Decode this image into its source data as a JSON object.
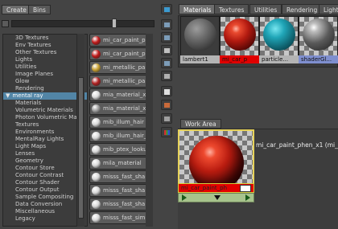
{
  "left_tabs": [
    "Create",
    "Bins"
  ],
  "tree": {
    "items": [
      {
        "label": "3D Textures",
        "kind": "top"
      },
      {
        "label": "Env Textures",
        "kind": "top"
      },
      {
        "label": "Other Textures",
        "kind": "top"
      },
      {
        "label": "Lights",
        "kind": "top"
      },
      {
        "label": "Utilities",
        "kind": "top"
      },
      {
        "label": "Image Planes",
        "kind": "top"
      },
      {
        "label": "Glow",
        "kind": "top"
      },
      {
        "label": "Rendering",
        "kind": "top"
      },
      {
        "label": "mental ray",
        "kind": "selected"
      },
      {
        "label": "Materials",
        "kind": "child"
      },
      {
        "label": "Volumetric Materials",
        "kind": "child"
      },
      {
        "label": "Photon Volumetric Ma...",
        "kind": "child"
      },
      {
        "label": "Textures",
        "kind": "child"
      },
      {
        "label": "Environments",
        "kind": "child"
      },
      {
        "label": "MentalRay Lights",
        "kind": "child"
      },
      {
        "label": "Light Maps",
        "kind": "child"
      },
      {
        "label": "Lenses",
        "kind": "child"
      },
      {
        "label": "Geometry",
        "kind": "child"
      },
      {
        "label": "Contour Store",
        "kind": "child"
      },
      {
        "label": "Contour Contrast",
        "kind": "child"
      },
      {
        "label": "Contour Shader",
        "kind": "child"
      },
      {
        "label": "Contour Output",
        "kind": "child"
      },
      {
        "label": "Sample Compositing",
        "kind": "child"
      },
      {
        "label": "Data Conversion",
        "kind": "child"
      },
      {
        "label": "Miscellaneous",
        "kind": "child"
      },
      {
        "label": "Legacy",
        "kind": "child"
      }
    ]
  },
  "nodes": [
    {
      "label": "mi_car_paint_p",
      "color": "#c01818"
    },
    {
      "label": "mi_car_paint_p",
      "color": "#c01818"
    },
    {
      "label": "mi_metallic_pai",
      "color": "#c8a030"
    },
    {
      "label": "mi_metallic_pai",
      "color": "#b02020"
    },
    {
      "label": "mia_material_x",
      "color": "#dcdcdc"
    },
    {
      "label": "mia_material_x",
      "color": "#9a9a9a"
    },
    {
      "label": "mib_illum_hair",
      "color": "#d8d8d8"
    },
    {
      "label": "mib_illum_hair_",
      "color": "#d8d8d8"
    },
    {
      "label": "mib_ptex_looku",
      "color": "#d8d8d8"
    },
    {
      "label": "mila_material",
      "color": "#d8d8d8"
    },
    {
      "label": "misss_fast_sha",
      "color": "#d8d8d8"
    },
    {
      "label": "misss_fast_sha",
      "color": "#d8d8d8"
    },
    {
      "label": "misss_fast_sha",
      "color": "#d8d8d8"
    },
    {
      "label": "misss_fast_sim",
      "color": "#d8d8d8"
    }
  ],
  "right_tabs": [
    "Materials",
    "Textures",
    "Utilities",
    "Rendering",
    "Light"
  ],
  "swatches": [
    {
      "label": "lambert1",
      "label_bg": "#b4b4b4",
      "kind": "gray"
    },
    {
      "label": "mi_car_p",
      "label_bg": "#e00000",
      "kind": "red"
    },
    {
      "label": "particle...",
      "label_bg": "#b4b4b4",
      "kind": "cyan"
    },
    {
      "label": "shaderGl...",
      "label_bg": "#7f8fcf",
      "kind": "glossy"
    }
  ],
  "work_area": {
    "tab_label": "Work Area",
    "node_label": "mi_car_paint_ph",
    "node_title": "mi_car_paint_phen_x1 (mi_car"
  },
  "colors": {
    "accent_selected": "#5285a6",
    "node_highlight": "#e7d35a",
    "car_paint_red": "#e20000"
  }
}
